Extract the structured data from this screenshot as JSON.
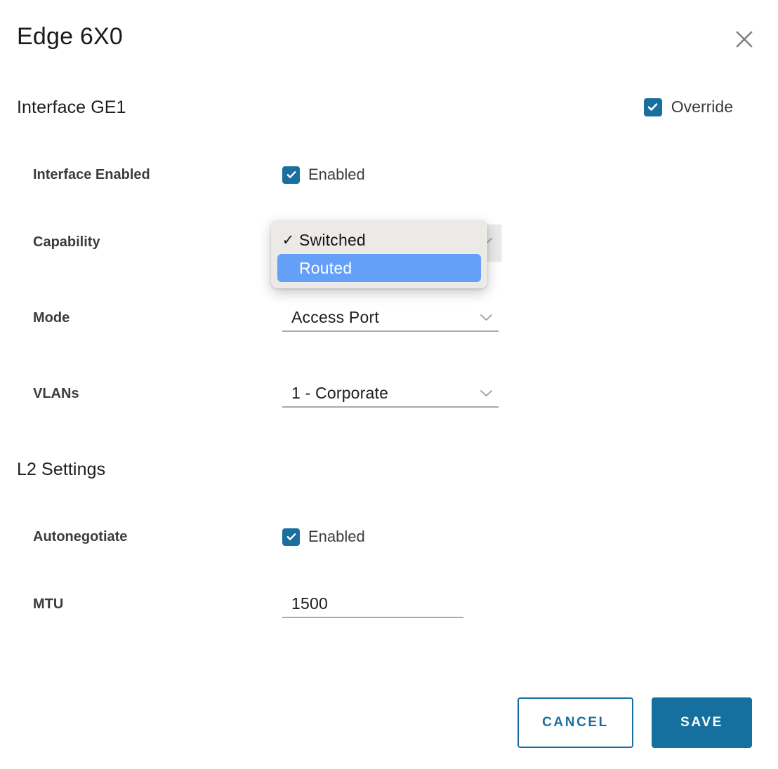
{
  "dialog": {
    "title": "Edge 6X0",
    "close_icon": "close-icon"
  },
  "sections": {
    "interface": {
      "heading": "Interface GE1",
      "override": {
        "label": "Override",
        "checked": true
      }
    },
    "l2": {
      "heading": "L2 Settings"
    }
  },
  "fields": {
    "interface_enabled": {
      "label": "Interface Enabled",
      "value": "Enabled",
      "checked": true
    },
    "capability": {
      "label": "Capability",
      "value": "Switched",
      "open": true,
      "options": [
        {
          "label": "Switched",
          "checked": true,
          "highlighted": false
        },
        {
          "label": "Routed",
          "checked": false,
          "highlighted": true
        }
      ]
    },
    "mode": {
      "label": "Mode",
      "value": "Access Port",
      "chevron_icon": "chevron-down-icon"
    },
    "vlans": {
      "label": "VLANs",
      "value": "1 - Corporate",
      "chevron_icon": "chevron-down-icon"
    },
    "autonegotiate": {
      "label": "Autonegotiate",
      "value": "Enabled",
      "checked": true
    },
    "mtu": {
      "label": "MTU",
      "value": "1500",
      "placeholder": ""
    }
  },
  "footer": {
    "cancel_label": "CANCEL",
    "save_label": "SAVE"
  },
  "colors": {
    "accent": "#16709f",
    "checkbox": "#1b6f9f",
    "popup_bg": "#eceae7",
    "popup_highlight": "#64a0f7",
    "underline": "#a9a9a9",
    "label": "#3c3c3c"
  }
}
